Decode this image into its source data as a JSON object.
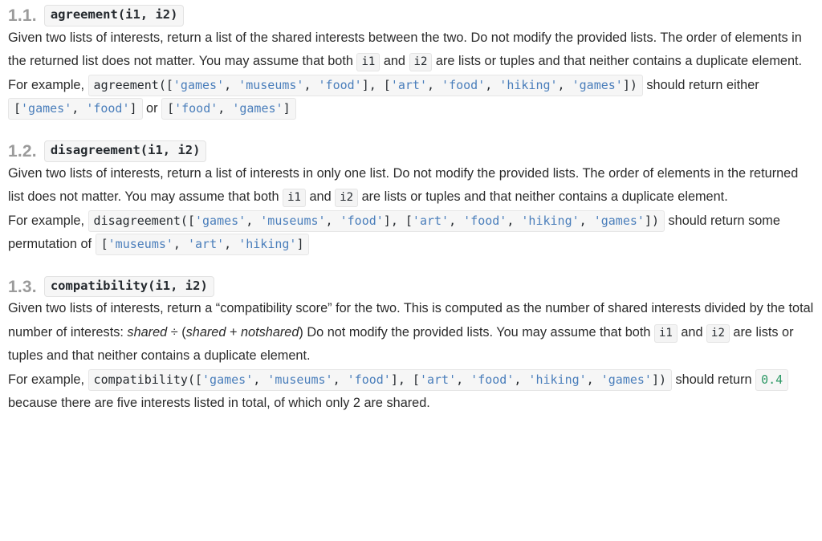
{
  "document": {
    "sections": [
      {
        "number": "1.1.",
        "signature": "agreement(i1, i2)",
        "description": {
          "part1": "Given two lists of interests, return a list of the shared interests between the two. Do not modify the provided lists. The order of elements in the returned list does not matter. You may assume that both ",
          "code_i1": "i1",
          "part2": " and ",
          "code_i2": "i2",
          "part3": " are lists or tuples and that neither contains a duplicate element."
        },
        "example": {
          "lead": "For example, ",
          "call_prefix": "agreement([",
          "call_args": [
            "'games'",
            "'museums'",
            "'food'"
          ],
          "call_mid": "], [",
          "call_args2": [
            "'art'",
            "'food'",
            "'hiking'",
            "'games'"
          ],
          "call_suffix": "])",
          "tail1": " should return either ",
          "result_a": [
            "'games'",
            "'food'"
          ],
          "tail2": " or ",
          "result_b": [
            "'food'",
            "'games'"
          ],
          "tail3": ""
        }
      },
      {
        "number": "1.2.",
        "signature": "disagreement(i1, i2)",
        "description": {
          "part1": "Given two lists of interests, return a list of interests in only one list. Do not modify the provided lists. The order of elements in the returned list does not matter. You may assume that both ",
          "code_i1": "i1",
          "part2": " and ",
          "code_i2": "i2",
          "part3": " are lists or tuples and that neither contains a duplicate element."
        },
        "example": {
          "lead": "For example, ",
          "call_prefix": "disagreement([",
          "call_args": [
            "'games'",
            "'museums'",
            "'food'"
          ],
          "call_mid": "], [",
          "call_args2": [
            "'art'",
            "'food'",
            "'hiking'",
            "'games'"
          ],
          "call_suffix": "])",
          "tail1": " should return some permutation of ",
          "result_a": [
            "'museums'",
            "'art'",
            "'hiking'"
          ],
          "tail2": "",
          "result_b": [],
          "tail3": ""
        }
      },
      {
        "number": "1.3.",
        "signature": "compatibility(i1, i2)",
        "description": {
          "part1": "Given two lists of interests, return a “compatibility score” for the two. This is computed as the number of shared interests divided by the total number of interests: ",
          "formula_a": "shared",
          "formula_div": " ÷ (",
          "formula_b": "shared",
          "formula_plus": " + ",
          "formula_c": "notshared",
          "formula_close": ") Do not modify the provided lists. You may assume that both ",
          "code_i1": "i1",
          "part2": " and ",
          "code_i2": "i2",
          "part3": " are lists or tuples and that neither contains a duplicate element."
        },
        "example": {
          "lead": "For example, ",
          "call_prefix": "compatibility([",
          "call_args": [
            "'games'",
            "'museums'",
            "'food'"
          ],
          "call_mid": "], [",
          "call_args2": [
            "'art'",
            "'food'",
            "'hiking'",
            "'games'"
          ],
          "call_suffix": "])",
          "tail1": " should return ",
          "return_value": "0.4",
          "tail2": " because there are five interests listed in total, of which only 2 are shared."
        }
      }
    ],
    "tokens": {
      "bracket_open": "[",
      "bracket_close": "]",
      "comma": ", "
    },
    "colors": {
      "string_literal": "#4a7ebb",
      "number_literal": "#2e9966",
      "code_text": "#24292e",
      "section_number": "#9b9b9b",
      "body_text": "#2b2b2b",
      "code_background": "#f6f6f6",
      "code_border": "#e6e6e6"
    }
  }
}
